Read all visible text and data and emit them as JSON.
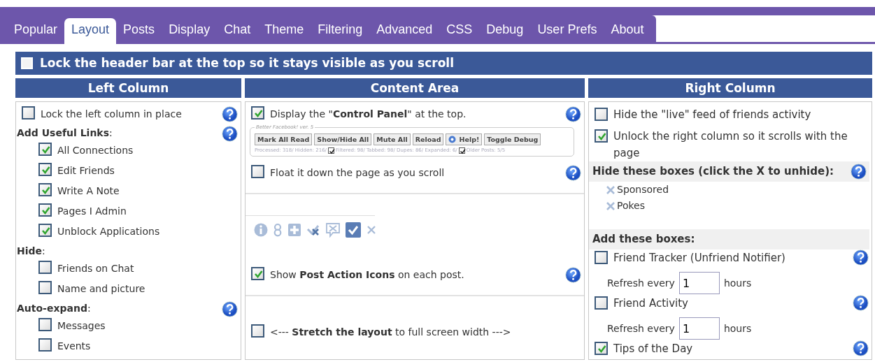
{
  "tabs": [
    {
      "label": "Popular",
      "selected": false
    },
    {
      "label": "Layout",
      "selected": true
    },
    {
      "label": "Posts",
      "selected": false
    },
    {
      "label": "Display",
      "selected": false
    },
    {
      "label": "Chat",
      "selected": false
    },
    {
      "label": "Theme",
      "selected": false
    },
    {
      "label": "Filtering",
      "selected": false
    },
    {
      "label": "Advanced",
      "selected": false
    },
    {
      "label": "CSS",
      "selected": false
    },
    {
      "label": "Debug",
      "selected": false
    },
    {
      "label": "User Prefs",
      "selected": false
    },
    {
      "label": "About",
      "selected": false
    }
  ],
  "lock_header": {
    "label": "Lock the header bar at the top so it stays visible as you scroll",
    "checked": false
  },
  "columns": [
    {
      "title": "Left Column",
      "items": [
        {
          "kind": "check",
          "label": "Lock the left column in place",
          "checked": false,
          "help": true
        },
        {
          "kind": "group",
          "label": "**Add Useful Links**:",
          "help": true,
          "children": [
            {
              "label": "All Connections",
              "checked": true
            },
            {
              "label": "Edit Friends",
              "checked": true
            },
            {
              "label": "Write A Note",
              "checked": true
            },
            {
              "label": "Pages I Admin",
              "checked": true
            },
            {
              "label": "Unblock Applications",
              "checked": true
            }
          ]
        },
        {
          "kind": "group",
          "label": "**Hide**:",
          "help": false,
          "children": [
            {
              "label": "Friends on Chat",
              "checked": false
            },
            {
              "label": "Name and picture",
              "checked": false
            }
          ]
        },
        {
          "kind": "group",
          "label": "**Auto-expand**:",
          "help": true,
          "children": [
            {
              "label": "Messages",
              "checked": false
            },
            {
              "label": "Events",
              "checked": false
            }
          ]
        }
      ]
    },
    {
      "title": "Content Area",
      "items": [
        {
          "kind": "check",
          "label": "Display the \"**Control Panel**\" at the top.",
          "checked": true,
          "help": true
        },
        {
          "kind": "panel_preview",
          "legend": "Better Facebook! ver. 5",
          "buttons": [
            {
              "label": "Mark All Read",
              "icon": false
            },
            {
              "label": "Show/Hide All",
              "icon": false
            },
            {
              "label": "Mute All",
              "icon": false
            },
            {
              "label": "Reload",
              "icon": false
            },
            {
              "label": "Help!",
              "icon": true
            },
            {
              "label": "Toggle Debug",
              "icon": false
            }
          ],
          "stats": [
            {
              "kind": "text",
              "text": "Processed: 318/ Hidden: 216/"
            },
            {
              "kind": "check",
              "checked": true
            },
            {
              "kind": "text",
              "text": "Filtered: 98/ Tabbed: 98/ Dupes: 86/ Expanded: 6/"
            },
            {
              "kind": "check",
              "checked": true
            },
            {
              "kind": "text",
              "text": "Older Posts: 5/5"
            }
          ]
        },
        {
          "kind": "check",
          "label": "Float it down the page as you scroll",
          "checked": false,
          "help": true
        },
        {
          "kind": "divider"
        },
        {
          "kind": "action_icons",
          "icons": [
            {
              "kind": "info",
              "highlighted": false
            },
            {
              "kind": "eight",
              "highlighted": false
            },
            {
              "kind": "plus",
              "highlighted": false
            },
            {
              "kind": "wrench",
              "highlighted": false
            },
            {
              "kind": "bubble",
              "highlighted": false
            },
            {
              "kind": "check",
              "highlighted": true
            },
            {
              "kind": "cross",
              "highlighted": false
            }
          ]
        },
        {
          "kind": "check",
          "label": "Show **Post Action Icons** on each post.",
          "checked": true,
          "help": true
        },
        {
          "kind": "divider"
        },
        {
          "kind": "check",
          "label": "<--- **Stretch the layout** to full screen width --->",
          "checked": false,
          "help": false
        }
      ]
    },
    {
      "title": "Right Column",
      "items": [
        {
          "kind": "check",
          "label": "Hide the \"live\" feed of friends activity",
          "checked": false,
          "help": false
        },
        {
          "kind": "check",
          "label": "Unlock the right column so it scrolls with the page",
          "checked": true,
          "help": false
        },
        {
          "kind": "section",
          "label": "Hide these boxes (click the X to unhide):",
          "help": true
        },
        {
          "kind": "hidden_box",
          "label": "Sponsored"
        },
        {
          "kind": "hidden_box",
          "label": "Pokes"
        },
        {
          "kind": "section",
          "label": "Add these boxes:",
          "help": false
        },
        {
          "kind": "check",
          "label": "Friend Tracker (Unfriend Notifier)",
          "checked": false,
          "help": true,
          "refresh": {
            "before": "Refresh every",
            "value": "1",
            "after": "hours"
          }
        },
        {
          "kind": "check",
          "label": "Friend Activity",
          "checked": false,
          "help": true,
          "refresh": {
            "before": "Refresh every",
            "value": "1",
            "after": "hours"
          }
        },
        {
          "kind": "check",
          "label": "Tips of the Day",
          "checked": true,
          "help": true
        }
      ]
    }
  ]
}
